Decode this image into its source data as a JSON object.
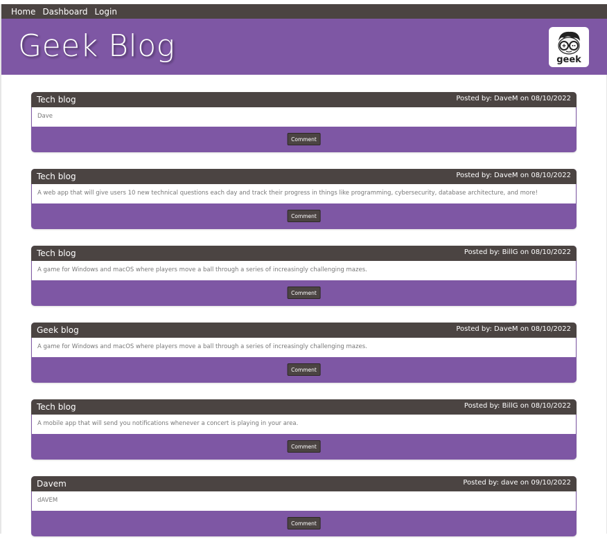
{
  "nav": {
    "items": [
      {
        "label": "Home"
      },
      {
        "label": "Dashboard"
      },
      {
        "label": "Login"
      }
    ]
  },
  "header": {
    "title": "Geek Blog",
    "logo_text": "geek"
  },
  "posts": [
    {
      "title": "Tech blog",
      "meta": "Posted by: DaveM on 08/10/2022",
      "body": "Dave",
      "button": "Comment"
    },
    {
      "title": "Tech blog",
      "meta": "Posted by: DaveM on 08/10/2022",
      "body": "A web app that will give users 10 new technical questions each day and track their progress in things like programming, cybersecurity, database architecture, and more!",
      "button": "Comment"
    },
    {
      "title": "Tech blog",
      "meta": "Posted by: BillG on 08/10/2022",
      "body": "A game for Windows and macOS where players move a ball through a series of increasingly challenging mazes.",
      "button": "Comment"
    },
    {
      "title": "Geek blog",
      "meta": "Posted by: DaveM on 08/10/2022",
      "body": "A game for Windows and macOS where players move a ball through a series of increasingly challenging mazes.",
      "button": "Comment"
    },
    {
      "title": "Tech blog",
      "meta": "Posted by: BillG on 08/10/2022",
      "body": "A mobile app that will send you notifications whenever a concert is playing in your area.",
      "button": "Comment"
    },
    {
      "title": "Davem",
      "meta": "Posted by: dave on 09/10/2022",
      "body": "dAVEM",
      "button": "Comment"
    }
  ],
  "colors": {
    "accent": "#7e57a4",
    "dark": "#4b4442"
  }
}
